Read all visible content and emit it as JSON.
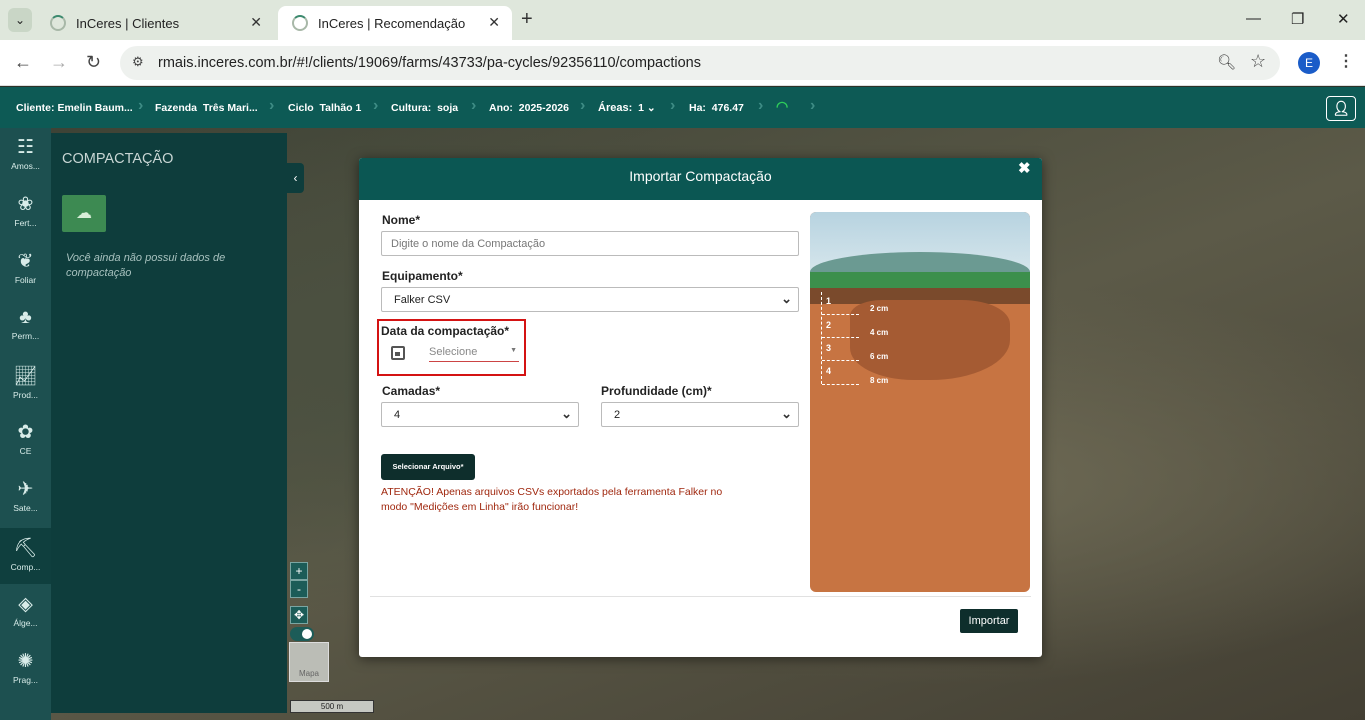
{
  "browser": {
    "tabs": [
      {
        "title": "InCeres | Clientes",
        "active": false
      },
      {
        "title": "InCeres | Recomendação",
        "active": true
      }
    ],
    "url": "rmais.inceres.com.br/#!/clients/19069/farms/43733/pa-cycles/92356110/compactions",
    "profile_initial": "E"
  },
  "header": {
    "cliente_label": "Cliente:",
    "cliente_value": "Emelin Baum...",
    "fazenda_label": "Fazenda",
    "fazenda_value": "Três Mari...",
    "ciclo_label": "Ciclo",
    "ciclo_value": "Talhão 1",
    "cultura_label": "Cultura:",
    "cultura_value": "soja",
    "ano_label": "Ano:",
    "ano_value": "2025-2026",
    "areas_label": "Áreas:",
    "areas_value": "1",
    "ha_label": "Ha:",
    "ha_value": "476.47"
  },
  "rail": {
    "items": [
      {
        "label": "Amos...",
        "icon": "samples-icon"
      },
      {
        "label": "Fert...",
        "icon": "fertility-icon"
      },
      {
        "label": "Foliar",
        "icon": "leaf-icon"
      },
      {
        "label": "Perm...",
        "icon": "permanent-icon"
      },
      {
        "label": "Prod...",
        "icon": "productivity-icon"
      },
      {
        "label": "CE",
        "icon": "ce-icon"
      },
      {
        "label": "Sate...",
        "icon": "satellite-icon"
      },
      {
        "label": "Comp...",
        "icon": "compaction-icon",
        "active": true
      },
      {
        "label": "Álge...",
        "icon": "layers-icon"
      },
      {
        "label": "Prag...",
        "icon": "pest-icon"
      }
    ]
  },
  "panel": {
    "title": "COMPACTAÇÃO",
    "empty_text": "Você ainda não possui dados de compactação"
  },
  "map": {
    "zoom_in": "+",
    "zoom_out": "-",
    "pan": "✥",
    "basemap_label": "Mapa",
    "scale_label": "500 m"
  },
  "modal": {
    "title": "Importar Compactação",
    "close": "✖",
    "nome_label": "Nome*",
    "nome_placeholder": "Digite o nome da Compactação",
    "equipamento_label": "Equipamento*",
    "equipamento_value": "Falker CSV",
    "data_label": "Data da compactação*",
    "data_placeholder": "Selecione",
    "camadas_label": "Camadas*",
    "camadas_value": "4",
    "profundidade_label": "Profundidade (cm)*",
    "profundidade_value": "2",
    "file_button": "Selecionar Arquivo*",
    "warning": "ATENÇÃO! Apenas arquivos CSVs exportados pela ferramenta Falker no modo \"Medições em Linha\" irão funcionar!",
    "import_button": "Importar",
    "layers": [
      {
        "n": "1",
        "depth": "2 cm"
      },
      {
        "n": "2",
        "depth": "4 cm"
      },
      {
        "n": "3",
        "depth": "6 cm"
      },
      {
        "n": "4",
        "depth": "8 cm"
      }
    ]
  },
  "colors": {
    "header_bg": "#0d5a55",
    "panel_bg": "#0e3d3c",
    "highlight_border": "#d41313",
    "warning_text": "#a0280f"
  }
}
